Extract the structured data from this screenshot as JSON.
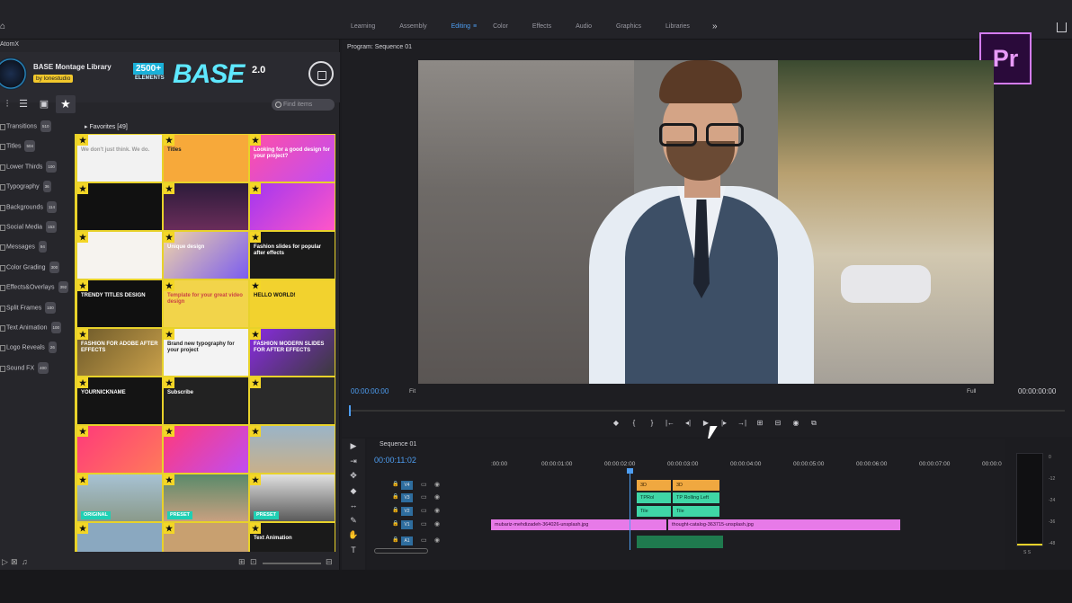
{
  "topbar": {
    "tabs": [
      "Learning",
      "Assembly",
      "Editing",
      "Color",
      "Effects",
      "Audio",
      "Graphics",
      "Libraries"
    ],
    "active_tab": "Editing",
    "editing_menu_glyph": "≡",
    "more_glyph": "»"
  },
  "plugin": {
    "panel_title": "AtomX",
    "library_name": "BASE Montage Library",
    "by": "by lonestudio",
    "banner_count": "2500+",
    "banner_elements": "ELEMENTS",
    "banner_base": "BASE",
    "banner_version": "2.0",
    "find_placeholder": "Find items",
    "favorites_label": "▸ Favorites [49]",
    "categories": [
      {
        "label": "Transitions",
        "count": "510"
      },
      {
        "label": "Titles",
        "count": "504"
      },
      {
        "label": "Lower Thirds",
        "count": "100"
      },
      {
        "label": "Typography",
        "count": "36"
      },
      {
        "label": "Backgrounds",
        "count": "114"
      },
      {
        "label": "Social Media",
        "count": "153"
      },
      {
        "label": "Messages",
        "count": "94"
      },
      {
        "label": "Color Grading",
        "count": "300"
      },
      {
        "label": "Effects&Overlays",
        "count": "392"
      },
      {
        "label": "Split Frames",
        "count": "100"
      },
      {
        "label": "Text Animation",
        "count": "100"
      },
      {
        "label": "Logo Reveals",
        "count": "26"
      },
      {
        "label": "Sound FX",
        "count": "400"
      }
    ],
    "thumbnails": [
      {
        "text": "We don't just think. We do.",
        "bg": "#f2f2f2",
        "fg": "#999"
      },
      {
        "text": "Titles",
        "bg": "#f7a93a",
        "fg": "#222"
      },
      {
        "text": "Looking for a good design for your project?",
        "bg": "linear-gradient(135deg,#ff4fa8,#c04df2)",
        "fg": "#fff"
      },
      {
        "text": "",
        "bg": "#111",
        "fg": "#fff"
      },
      {
        "text": "",
        "bg": "linear-gradient(180deg,#2c1b3a,#6a2d5a)",
        "fg": "#fff"
      },
      {
        "text": "",
        "bg": "linear-gradient(135deg,#a236f0,#ff56c8)",
        "fg": "#fff"
      },
      {
        "text": "",
        "bg": "#f6f3ef",
        "fg": "#333"
      },
      {
        "text": "Unique design",
        "bg": "linear-gradient(135deg,#f0d4a8,#7a5cf0)",
        "fg": "#fff"
      },
      {
        "text": "Fashion slides for popular after effects",
        "bg": "#1a1a1a",
        "fg": "#fff"
      },
      {
        "text": "TRENDY TITLES DESIGN",
        "bg": "#101010",
        "fg": "#fff"
      },
      {
        "text": "Template for your great video design",
        "bg": "#f2d44a",
        "fg": "#c44"
      },
      {
        "text": "HELLO WORLD!",
        "bg": "#f2d22e",
        "fg": "#111"
      },
      {
        "text": "FASHION FOR ADOBE AFTER EFFECTS",
        "bg": "linear-gradient(135deg,#6e5a2a,#c9a04a)",
        "fg": "#fff"
      },
      {
        "text": "Brand new typography for your project",
        "bg": "#f3f3f3",
        "fg": "#222"
      },
      {
        "text": "FASHION MODERN SLIDES FOR AFTER EFFECTS",
        "bg": "linear-gradient(135deg,#8a2be2,#3a3a3a)",
        "fg": "#fff"
      },
      {
        "text": "YOURNICKNAME",
        "bg": "#141414",
        "fg": "#fff"
      },
      {
        "text": "Subscribe",
        "bg": "#222",
        "fg": "#fff"
      },
      {
        "text": "",
        "bg": "#2a2a2a",
        "fg": "#fff"
      },
      {
        "text": "",
        "bg": "linear-gradient(135deg,#ff3a7a,#ff7a5a)",
        "fg": "#fff"
      },
      {
        "text": "",
        "bg": "linear-gradient(135deg,#ff3a7a,#c04df2)",
        "fg": "#fff"
      },
      {
        "text": "",
        "bg": "linear-gradient(180deg,#9ab4c8,#c8b08a)",
        "fg": "#fff"
      },
      {
        "text": "",
        "bg": "linear-gradient(180deg,#a7c2d4,#8a9a8a)",
        "fg": "#fff",
        "tag": "ORIGINAL"
      },
      {
        "text": "",
        "bg": "linear-gradient(180deg,#5a8a6a,#c8a080)",
        "fg": "#fff",
        "tag": "PRESET"
      },
      {
        "text": "",
        "bg": "linear-gradient(180deg,#e0e0e0,#5a5a5a)",
        "fg": "#fff",
        "tag": "PRESET"
      },
      {
        "text": "",
        "bg": "#8aa8c0",
        "fg": "#fff"
      },
      {
        "text": "",
        "bg": "#c8a070",
        "fg": "#fff"
      },
      {
        "text": "Text Animation",
        "bg": "#1a1a1a",
        "fg": "#fff"
      }
    ],
    "thumb_tags_row": [
      "ORIGINAL",
      "PRESET"
    ]
  },
  "program": {
    "title": "Program: Sequence 01",
    "timecode": "00:00:00:00",
    "fit": "Fit",
    "quality": "Full",
    "duration": "00:00:00:00",
    "transport": [
      "◆",
      "{",
      "}",
      "|←",
      "◂|",
      "▶",
      "|▸",
      "→|",
      "⊞",
      "⊟",
      "◉",
      "⧉"
    ],
    "app_logo": "Pr"
  },
  "timeline": {
    "sequence_label": "Sequence 01",
    "timecode": "00:00:11:02",
    "ruler": [
      ":00:00",
      "00:00:01:00",
      "00:00:02:00",
      "00:00:03:00",
      "00:00:04:00",
      "00:00:05:00",
      "00:00:06:00",
      "00:00:07:00",
      "00:00:0"
    ],
    "tracks": [
      "V4",
      "V3",
      "V2",
      "V1",
      "A1"
    ],
    "clips": {
      "v4a": "3D",
      "v4b": "3D",
      "v3a": "TPRol",
      "v3b": "TP Rolling Left",
      "v2a": "Tile",
      "v2b": "Tile",
      "v1a": "mubariz-mehdizadeh-364026-unsplash.jpg",
      "v1b": "thought-catalog-363715-unsplash.jpg"
    }
  },
  "meter": {
    "labels": [
      "0",
      "-12",
      "-24",
      "-36",
      "-48"
    ],
    "foot": "S   S"
  },
  "tools": [
    "▶",
    "⇥",
    "✥",
    "◆",
    "↔",
    "✎",
    "✋",
    "T"
  ]
}
